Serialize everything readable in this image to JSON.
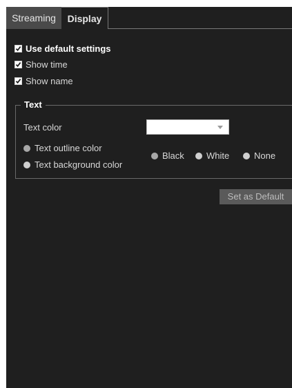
{
  "tabs": [
    {
      "label": "Streaming"
    },
    {
      "label": "Display"
    }
  ],
  "options": {
    "use_default": {
      "label": "Use default settings",
      "checked": true
    },
    "show_time": {
      "label": "Show time",
      "checked": true
    },
    "show_name": {
      "label": "Show name",
      "checked": true
    }
  },
  "text_section": {
    "legend": "Text",
    "text_color_label": "Text color",
    "text_color_value": "",
    "outline_label": "Text outline color",
    "background_label": "Text background color",
    "color_choices": [
      {
        "label": "Black"
      },
      {
        "label": "White"
      },
      {
        "label": "None"
      }
    ]
  },
  "actions": {
    "set_default_label": "Set as Default"
  },
  "colors": {
    "panel_bg": "#1f1f1f",
    "active_tab_bg": "#4a4a4a",
    "button_bg": "#5a5a5a"
  }
}
